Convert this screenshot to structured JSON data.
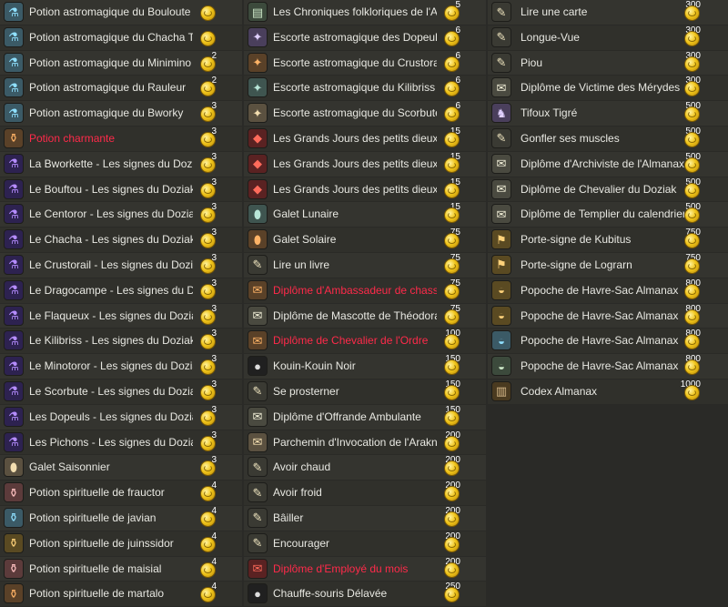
{
  "columns": [
    {
      "items": [
        {
          "name": "Potion astromagique du Bouloute",
          "price": "",
          "icon": "potion-icon",
          "tint": "t-potion",
          "glyph": "⚗",
          "red": false
        },
        {
          "name": "Potion astromagique du Chacha Tigré",
          "price": "",
          "icon": "potion-icon",
          "tint": "t-potion",
          "glyph": "⚗",
          "red": false
        },
        {
          "name": "Potion astromagique du Minimino",
          "price": "2",
          "icon": "potion-icon",
          "tint": "t-potion",
          "glyph": "⚗",
          "red": false
        },
        {
          "name": "Potion astromagique du Rauleur",
          "price": "2",
          "icon": "potion-icon",
          "tint": "t-potion",
          "glyph": "⚗",
          "red": false
        },
        {
          "name": "Potion astromagique du Bworky",
          "price": "3",
          "icon": "potion-icon",
          "tint": "t-potion",
          "glyph": "⚗",
          "red": false
        },
        {
          "name": "Potion charmante",
          "price": "3",
          "icon": "potion-icon",
          "tint": "t-orange",
          "glyph": "⚱",
          "red": true
        },
        {
          "name": "La Bworkette - Les signes du Doziak",
          "price": "3",
          "icon": "sign-potion-icon",
          "tint": "t-purple",
          "glyph": "⚗",
          "red": false
        },
        {
          "name": "Le Bouftou - Les signes du Doziak",
          "price": "3",
          "icon": "sign-potion-icon",
          "tint": "t-purple",
          "glyph": "⚗",
          "red": false
        },
        {
          "name": "Le Centoror - Les signes du Doziak",
          "price": "3",
          "icon": "sign-potion-icon",
          "tint": "t-purple",
          "glyph": "⚗",
          "red": false
        },
        {
          "name": "Le Chacha - Les signes du Doziak V",
          "price": "3",
          "icon": "sign-potion-icon",
          "tint": "t-purple",
          "glyph": "⚗",
          "red": false
        },
        {
          "name": "Le Crustorail - Les signes du Doziak",
          "price": "3",
          "icon": "sign-potion-icon",
          "tint": "t-purple",
          "glyph": "⚗",
          "red": false
        },
        {
          "name": "Le Dragocampe - Les signes du Doziak",
          "price": "3",
          "icon": "sign-potion-icon",
          "tint": "t-purple",
          "glyph": "⚗",
          "red": false
        },
        {
          "name": "Le Flaqueux - Les signes du Doziak",
          "price": "3",
          "icon": "sign-potion-icon",
          "tint": "t-purple",
          "glyph": "⚗",
          "red": false
        },
        {
          "name": "Le Kilibriss - Les signes du Doziak",
          "price": "3",
          "icon": "sign-potion-icon",
          "tint": "t-purple",
          "glyph": "⚗",
          "red": false
        },
        {
          "name": "Le Minotoror - Les signes du Doziak",
          "price": "3",
          "icon": "sign-potion-icon",
          "tint": "t-purple",
          "glyph": "⚗",
          "red": false
        },
        {
          "name": "Le Scorbute - Les signes du Doziak",
          "price": "3",
          "icon": "sign-potion-icon",
          "tint": "t-purple",
          "glyph": "⚗",
          "red": false
        },
        {
          "name": "Les Dopeuls - Les signes du Doziak",
          "price": "3",
          "icon": "sign-potion-icon",
          "tint": "t-purple",
          "glyph": "⚗",
          "red": false
        },
        {
          "name": "Les Pichons - Les signes du Doziak",
          "price": "3",
          "icon": "sign-potion-icon",
          "tint": "t-purple",
          "glyph": "⚗",
          "red": false
        },
        {
          "name": "Galet Saisonnier",
          "price": "3",
          "icon": "pebble-icon",
          "tint": "t-beige",
          "glyph": "⬮",
          "red": false
        },
        {
          "name": "Potion spirituelle de frauctor",
          "price": "4",
          "icon": "spirit-potion-icon",
          "tint": "t-pink",
          "glyph": "⚱",
          "red": false
        },
        {
          "name": "Potion spirituelle de javian",
          "price": "4",
          "icon": "spirit-potion-icon",
          "tint": "t-potion",
          "glyph": "⚱",
          "red": false
        },
        {
          "name": "Potion spirituelle de juinssidor",
          "price": "4",
          "icon": "spirit-potion-icon",
          "tint": "t-bag",
          "glyph": "⚱",
          "red": false
        },
        {
          "name": "Potion spirituelle de maisial",
          "price": "4",
          "icon": "spirit-potion-icon",
          "tint": "t-pink",
          "glyph": "⚱",
          "red": false
        },
        {
          "name": "Potion spirituelle de martalo",
          "price": "4",
          "icon": "spirit-potion-icon",
          "tint": "t-orange",
          "glyph": "⚱",
          "red": false
        }
      ]
    },
    {
      "items": [
        {
          "name": "Les Chroniques folkloriques de l'Almanax",
          "price": "5",
          "icon": "book-icon",
          "tint": "t-book",
          "glyph": "▤",
          "red": false
        },
        {
          "name": "Escorte astromagique des Dopeuls",
          "price": "6",
          "icon": "star-escort-icon",
          "tint": "t-star",
          "glyph": "✦",
          "red": false
        },
        {
          "name": "Escorte astromagique du Crustorail",
          "price": "6",
          "icon": "star-escort-icon",
          "tint": "t-orange",
          "glyph": "✦",
          "red": false
        },
        {
          "name": "Escorte astromagique du Kilibriss",
          "price": "6",
          "icon": "star-escort-icon",
          "tint": "t-stone",
          "glyph": "✦",
          "red": false
        },
        {
          "name": "Escorte astromagique du Scorbute",
          "price": "6",
          "icon": "star-escort-icon",
          "tint": "t-beige",
          "glyph": "✦",
          "red": false
        },
        {
          "name": "Les Grands Jours des petits dieux I",
          "price": "15",
          "icon": "red-book-icon",
          "tint": "t-red",
          "glyph": "◆",
          "red": false
        },
        {
          "name": "Les Grands Jours des petits dieux II",
          "price": "15",
          "icon": "red-book-icon",
          "tint": "t-red",
          "glyph": "◆",
          "red": false
        },
        {
          "name": "Les Grands Jours des petits dieux III",
          "price": "15",
          "icon": "red-book-icon",
          "tint": "t-red",
          "glyph": "◆",
          "red": false
        },
        {
          "name": "Galet Lunaire",
          "price": "15",
          "icon": "moon-pebble-icon",
          "tint": "t-stone",
          "glyph": "⬮",
          "red": false
        },
        {
          "name": "Galet Solaire",
          "price": "75",
          "icon": "sun-pebble-icon",
          "tint": "t-orange",
          "glyph": "⬮",
          "red": false
        },
        {
          "name": "Lire un livre",
          "price": "75",
          "icon": "scroll-icon",
          "tint": "t-hand",
          "glyph": "✎",
          "red": false
        },
        {
          "name": "Diplôme d'Ambassadeur de chasse",
          "price": "75",
          "icon": "diploma-icon",
          "tint": "t-orange",
          "glyph": "✉",
          "red": true
        },
        {
          "name": "Diplôme de Mascotte de Théodoran",
          "price": "75",
          "icon": "diploma-icon",
          "tint": "t-scroll",
          "glyph": "✉",
          "red": false
        },
        {
          "name": "Diplôme de Chevalier de l'Ordre",
          "price": "100",
          "icon": "diploma-icon",
          "tint": "t-orange",
          "glyph": "✉",
          "red": true
        },
        {
          "name": "Kouin-Kouin Noir",
          "price": "150",
          "icon": "pet-icon",
          "tint": "t-black",
          "glyph": "●",
          "red": false
        },
        {
          "name": "Se prosterner",
          "price": "150",
          "icon": "emote-icon",
          "tint": "t-hand",
          "glyph": "✎",
          "red": false
        },
        {
          "name": "Diplôme d'Offrande Ambulante",
          "price": "150",
          "icon": "diploma-icon",
          "tint": "t-scroll",
          "glyph": "✉",
          "red": false
        },
        {
          "name": "Parchemin d'Invocation de l'Arakne",
          "price": "200",
          "icon": "parchment-icon",
          "tint": "t-beige",
          "glyph": "✉",
          "red": false
        },
        {
          "name": "Avoir chaud",
          "price": "200",
          "icon": "emote-icon",
          "tint": "t-hand",
          "glyph": "✎",
          "red": false
        },
        {
          "name": "Avoir froid",
          "price": "200",
          "icon": "emote-icon",
          "tint": "t-hand",
          "glyph": "✎",
          "red": false
        },
        {
          "name": "Bâiller",
          "price": "200",
          "icon": "emote-icon",
          "tint": "t-hand",
          "glyph": "✎",
          "red": false
        },
        {
          "name": "Encourager",
          "price": "200",
          "icon": "emote-icon",
          "tint": "t-hand",
          "glyph": "✎",
          "red": false
        },
        {
          "name": "Diplôme d'Employé du mois",
          "price": "200",
          "icon": "diploma-icon",
          "tint": "t-red",
          "glyph": "✉",
          "red": true
        },
        {
          "name": "Chauffe-souris Délavée",
          "price": "250",
          "icon": "pet-icon",
          "tint": "t-black",
          "glyph": "●",
          "red": false
        }
      ]
    },
    {
      "items": [
        {
          "name": "Lire une carte",
          "price": "300",
          "icon": "emote-icon",
          "tint": "t-hand",
          "glyph": "✎",
          "red": false
        },
        {
          "name": "Longue-Vue",
          "price": "300",
          "icon": "emote-icon",
          "tint": "t-hand",
          "glyph": "✎",
          "red": false
        },
        {
          "name": "Piou",
          "price": "300",
          "icon": "emote-icon",
          "tint": "t-hand",
          "glyph": "✎",
          "red": false
        },
        {
          "name": "Diplôme de Victime des Mérydes",
          "price": "300",
          "icon": "diploma-icon",
          "tint": "t-scroll",
          "glyph": "✉",
          "red": false
        },
        {
          "name": "Tifoux Tigré",
          "price": "500",
          "icon": "pet-icon",
          "tint": "t-star",
          "glyph": "♞",
          "red": false
        },
        {
          "name": "Gonfler ses muscles",
          "price": "500",
          "icon": "emote-icon",
          "tint": "t-hand",
          "glyph": "✎",
          "red": false
        },
        {
          "name": "Diplôme d'Archiviste de l'Almanax",
          "price": "500",
          "icon": "diploma-icon",
          "tint": "t-scroll",
          "glyph": "✉",
          "red": false
        },
        {
          "name": "Diplôme de Chevalier du Doziak",
          "price": "500",
          "icon": "diploma-icon",
          "tint": "t-scroll",
          "glyph": "✉",
          "red": false
        },
        {
          "name": "Diplôme de Templier du calendrier",
          "price": "500",
          "icon": "diploma-icon",
          "tint": "t-scroll",
          "glyph": "✉",
          "red": false
        },
        {
          "name": "Porte-signe de Kubitus",
          "price": "750",
          "icon": "sign-icon",
          "tint": "t-bag",
          "glyph": "⚑",
          "red": false
        },
        {
          "name": "Porte-signe de Lograrn",
          "price": "750",
          "icon": "sign-icon",
          "tint": "t-bag",
          "glyph": "⚑",
          "red": false
        },
        {
          "name": "Popoche de Havre-Sac Almanax",
          "price": "800",
          "icon": "bag-icon",
          "tint": "t-bag",
          "glyph": "◒",
          "red": false
        },
        {
          "name": "Popoche de Havre-Sac Almanax",
          "price": "800",
          "icon": "bag-icon",
          "tint": "t-bag",
          "glyph": "◒",
          "red": false
        },
        {
          "name": "Popoche de Havre-Sac Almanax",
          "price": "800",
          "icon": "bag-icon",
          "tint": "t-potion",
          "glyph": "◒",
          "red": false
        },
        {
          "name": "Popoche de Havre-Sac Almanax",
          "price": "800",
          "icon": "bag-icon",
          "tint": "t-book",
          "glyph": "◒",
          "red": false
        },
        {
          "name": "Codex Almanax",
          "price": "1000",
          "icon": "codex-icon",
          "tint": "t-codex",
          "glyph": "▥",
          "red": false
        }
      ]
    }
  ]
}
